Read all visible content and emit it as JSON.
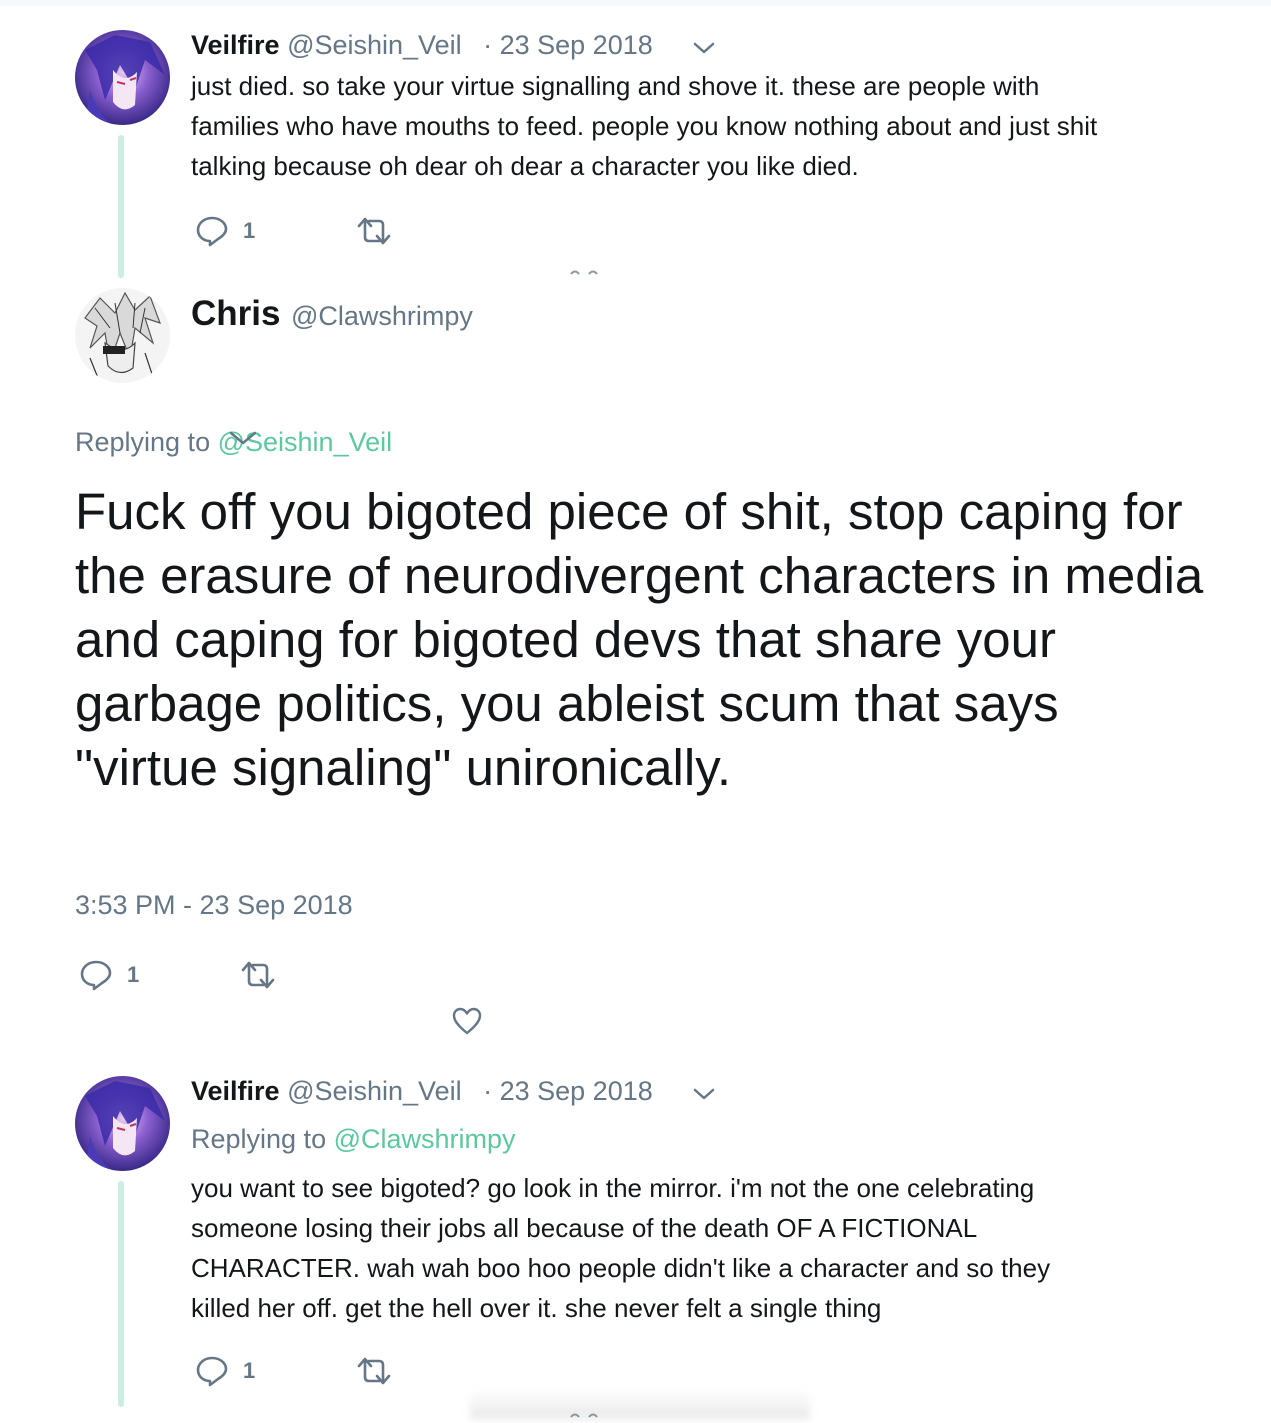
{
  "tweet1": {
    "name": "Veilfire",
    "handle": "@Seishin_Veil",
    "date": "· 23 Sep 2018",
    "text": "just died. so take your virtue signalling and shove it. these are people with\nfamilies who have mouths to feed. people you know nothing about and just shit\ntalking because oh dear oh dear a character you like died.",
    "reply_count": "1",
    "avatar_icon": "anime-avatar-icon"
  },
  "main_tweet": {
    "name": "Chris",
    "handle": "@Clawshrimpy",
    "replying_prefix": "Replying to",
    "replying_to": "@Seishin_Veil",
    "text": "Fuck off you bigoted piece of shit, stop caping for the erasure of neurodivergent characters in media and caping for bigoted devs that share your garbage politics, you ableist scum that says \"virtue signaling\" unironically.",
    "timestamp": "3:53 PM - 23 Sep 2018",
    "reply_count": "1",
    "avatar_icon": "sketch-avatar-icon"
  },
  "tweet3": {
    "name": "Veilfire",
    "handle": "@Seishin_Veil",
    "date": "· 23 Sep 2018",
    "replying_prefix": "Replying to",
    "replying_to": "@Clawshrimpy",
    "text": "you want to see bigoted? go look in the mirror. i'm not the one celebrating\nsomeone losing their jobs all because of the death OF A FICTIONAL\nCHARACTER. wah wah boo hoo people didn't like a character and so they\nkilled her off. get the hell over it. she never felt a single thing",
    "reply_count": "1",
    "avatar_icon": "anime-avatar-icon"
  },
  "colors": {
    "text": "#14171a",
    "secondary": "#657786",
    "link": "#5cc8a0",
    "thread_line": "#c8efe0"
  }
}
